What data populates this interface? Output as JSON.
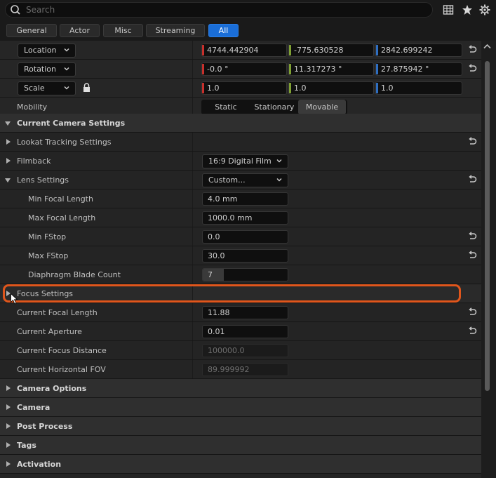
{
  "search": {
    "placeholder": "Search"
  },
  "tabs": [
    "General",
    "Actor",
    "Misc",
    "Streaming",
    "All"
  ],
  "transform": {
    "location": {
      "label": "Location",
      "x": "4744.442904",
      "y": "-775.630528",
      "z": "2842.699242"
    },
    "rotation": {
      "label": "Rotation",
      "x": "-0.0 °",
      "y": "11.317273 °",
      "z": "27.875942 °"
    },
    "scale": {
      "label": "Scale",
      "x": "1.0",
      "y": "1.0",
      "z": "1.0"
    }
  },
  "mobility": {
    "label": "Mobility",
    "options": [
      "Static",
      "Stationary",
      "Movable"
    ],
    "selected": "Movable"
  },
  "camera_settings": {
    "header": "Current Camera Settings",
    "lookat": "Lookat Tracking Settings",
    "filmback": {
      "label": "Filmback",
      "value": "16:9 Digital Film"
    },
    "lens": {
      "label": "Lens Settings",
      "value": "Custom..."
    },
    "min_focal": {
      "label": "Min Focal Length",
      "value": "4.0 mm"
    },
    "max_focal": {
      "label": "Max Focal Length",
      "value": "1000.0 mm"
    },
    "min_fstop": {
      "label": "Min FStop",
      "value": "0.0"
    },
    "max_fstop": {
      "label": "Max FStop",
      "value": "30.0"
    },
    "blade_count": {
      "label": "Diaphragm Blade Count",
      "value": "7"
    },
    "focus": "Focus Settings",
    "cur_focal": {
      "label": "Current Focal Length",
      "value": "11.88"
    },
    "cur_aperture": {
      "label": "Current Aperture",
      "value": "0.01"
    },
    "cur_focus_dist": {
      "label": "Current Focus Distance",
      "value": "100000.0"
    },
    "cur_fov": {
      "label": "Current Horizontal FOV",
      "value": "89.999992"
    }
  },
  "categories": [
    "Camera Options",
    "Camera",
    "Post Process",
    "Tags",
    "Activation"
  ],
  "colors": {
    "accent": "#1a6ed8",
    "x_axis": "#c8302c",
    "y_axis": "#7fa033",
    "z_axis": "#2f6fc2",
    "highlight": "#e0561c"
  }
}
